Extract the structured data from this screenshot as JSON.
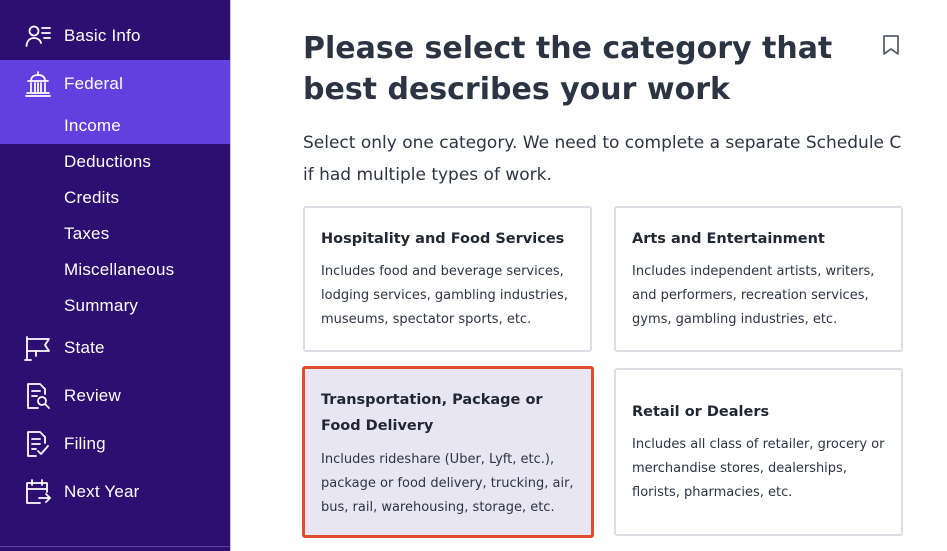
{
  "sidebar": {
    "items": [
      {
        "label": "Basic Info",
        "icon": "user-list-icon"
      },
      {
        "label": "Federal",
        "icon": "capitol-building-icon"
      },
      {
        "label": "State",
        "icon": "flag-icon"
      },
      {
        "label": "Review",
        "icon": "document-search-icon"
      },
      {
        "label": "Filing",
        "icon": "document-check-icon"
      },
      {
        "label": "Next Year",
        "icon": "calendar-arrow-icon"
      }
    ],
    "federal_sub_items": [
      "Income",
      "Deductions",
      "Credits",
      "Taxes",
      "Miscellaneous",
      "Summary"
    ],
    "colors": {
      "background": "#2d0f72",
      "active": "#6240e0"
    }
  },
  "main": {
    "title": "Please select the category that best describes your work",
    "subtitle": "Select only one category. We need to complete a separate Schedule C if had multiple types of work.",
    "bookmark_icon": "bookmark-icon",
    "cards": [
      {
        "title": "Hospitality and Food Services",
        "description": "Includes food and beverage services, lodging services, gambling industries, museums, spectator sports, etc.",
        "selected": false
      },
      {
        "title": "Arts and Entertainment",
        "description": "Includes independent artists, writers, and performers, recreation services, gyms, gambling industries, etc.",
        "selected": false
      },
      {
        "title": "Transportation, Package or Food Delivery",
        "description": "Includes rideshare (Uber, Lyft, etc.), package or food delivery, trucking, air, bus, rail, warehousing, storage, etc.",
        "selected": true
      },
      {
        "title": "Retail or Dealers",
        "description": "Includes all class of retailer, grocery or merchandise stores, dealerships, florists, pharmacies, etc.",
        "selected": false
      }
    ],
    "colors": {
      "selected_border": "#e14b2f",
      "selected_bg": "#e8e6f3"
    }
  }
}
